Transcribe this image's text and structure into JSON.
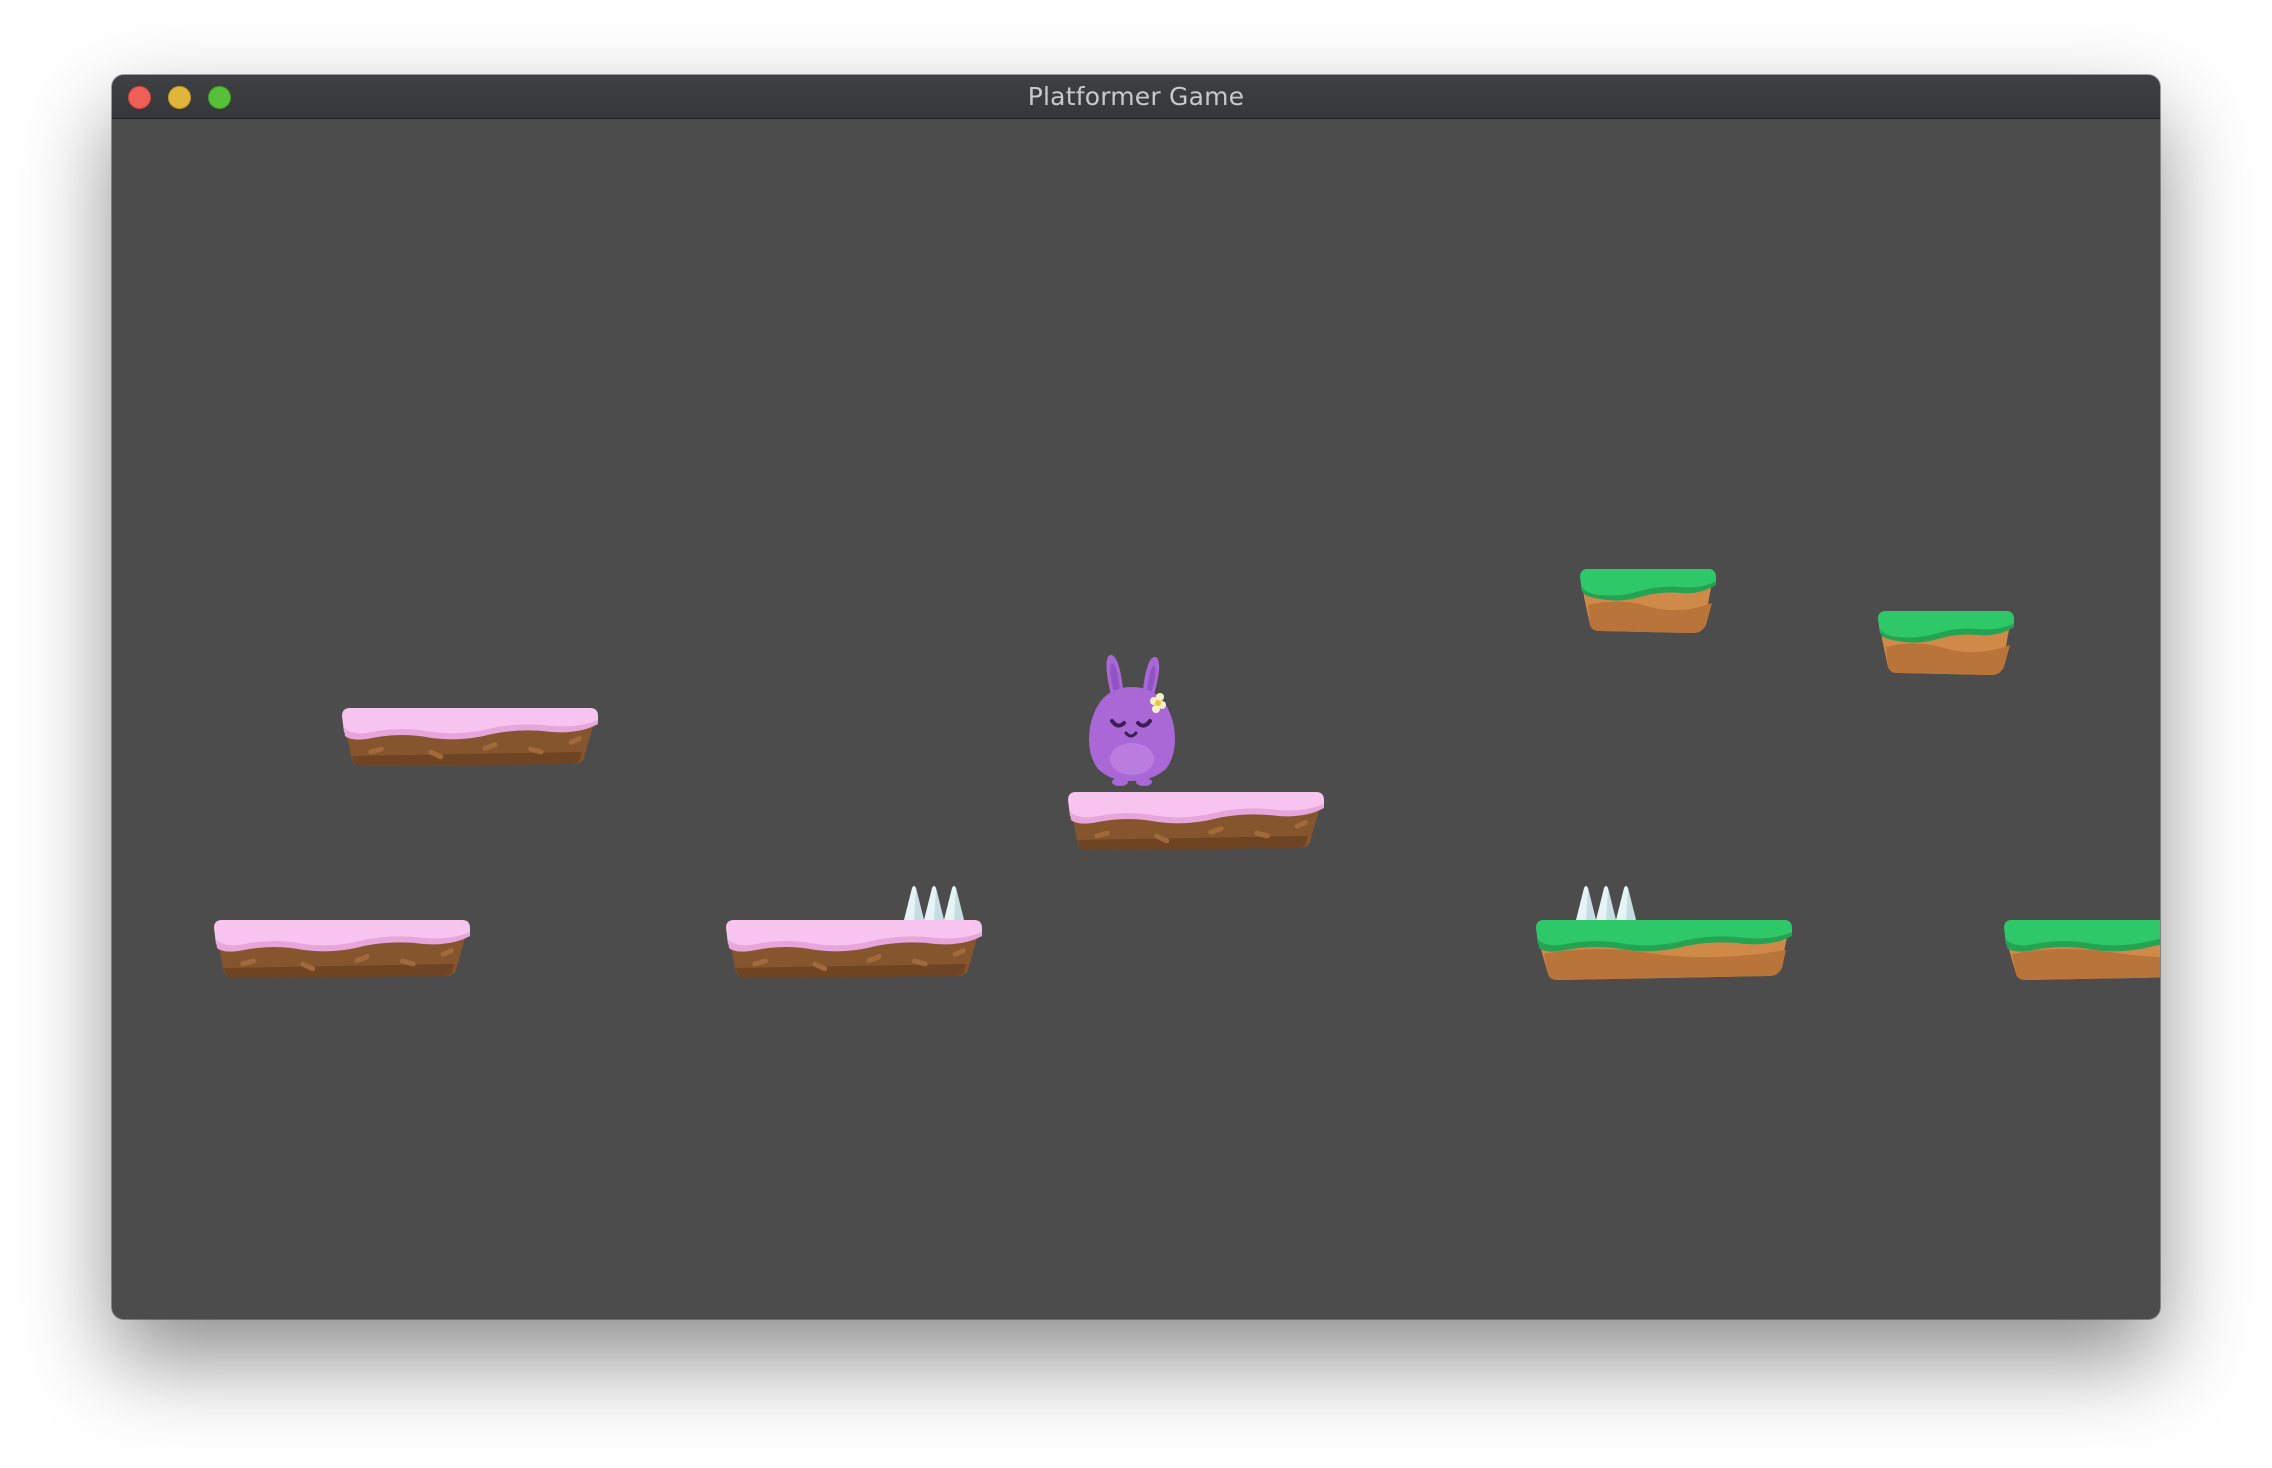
{
  "window": {
    "title": "Platformer Game"
  },
  "scene": {
    "background_color": "#4c4c4c",
    "player": {
      "character": "purple-bunny",
      "color": "#a968d6"
    },
    "platform_themes": {
      "candy": {
        "top": "#f7c4f0",
        "body": "#85552d"
      },
      "grass": {
        "top": "#2fc868",
        "body": "#cf8a4a"
      }
    },
    "hazards": [
      "spikes",
      "spikes"
    ]
  }
}
